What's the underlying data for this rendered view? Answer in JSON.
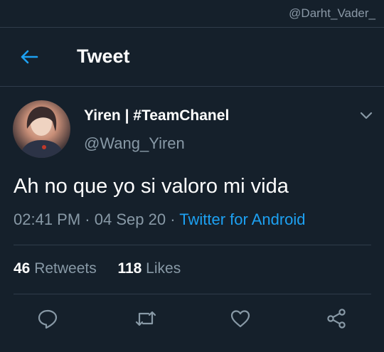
{
  "watermark": "@Darht_Vader_",
  "header": {
    "title": "Tweet",
    "back_icon": "arrow-left-icon",
    "accent": "#1da1f2"
  },
  "tweet": {
    "display_name": "Yiren | #TeamChanel",
    "handle": "@Wang_Yiren",
    "text": "Ah no que yo si valoro mi vida",
    "time": "02:41 PM",
    "date": "04 Sep 20",
    "source": "Twitter for Android",
    "retweets_count": "46",
    "retweets_label": "Retweets",
    "likes_count": "118",
    "likes_label": "Likes"
  },
  "actions": [
    "reply-icon",
    "retweet-icon",
    "like-icon",
    "share-icon"
  ],
  "colors": {
    "background": "#15202b",
    "muted": "#8899a6",
    "divider": "#2f3c4a"
  }
}
